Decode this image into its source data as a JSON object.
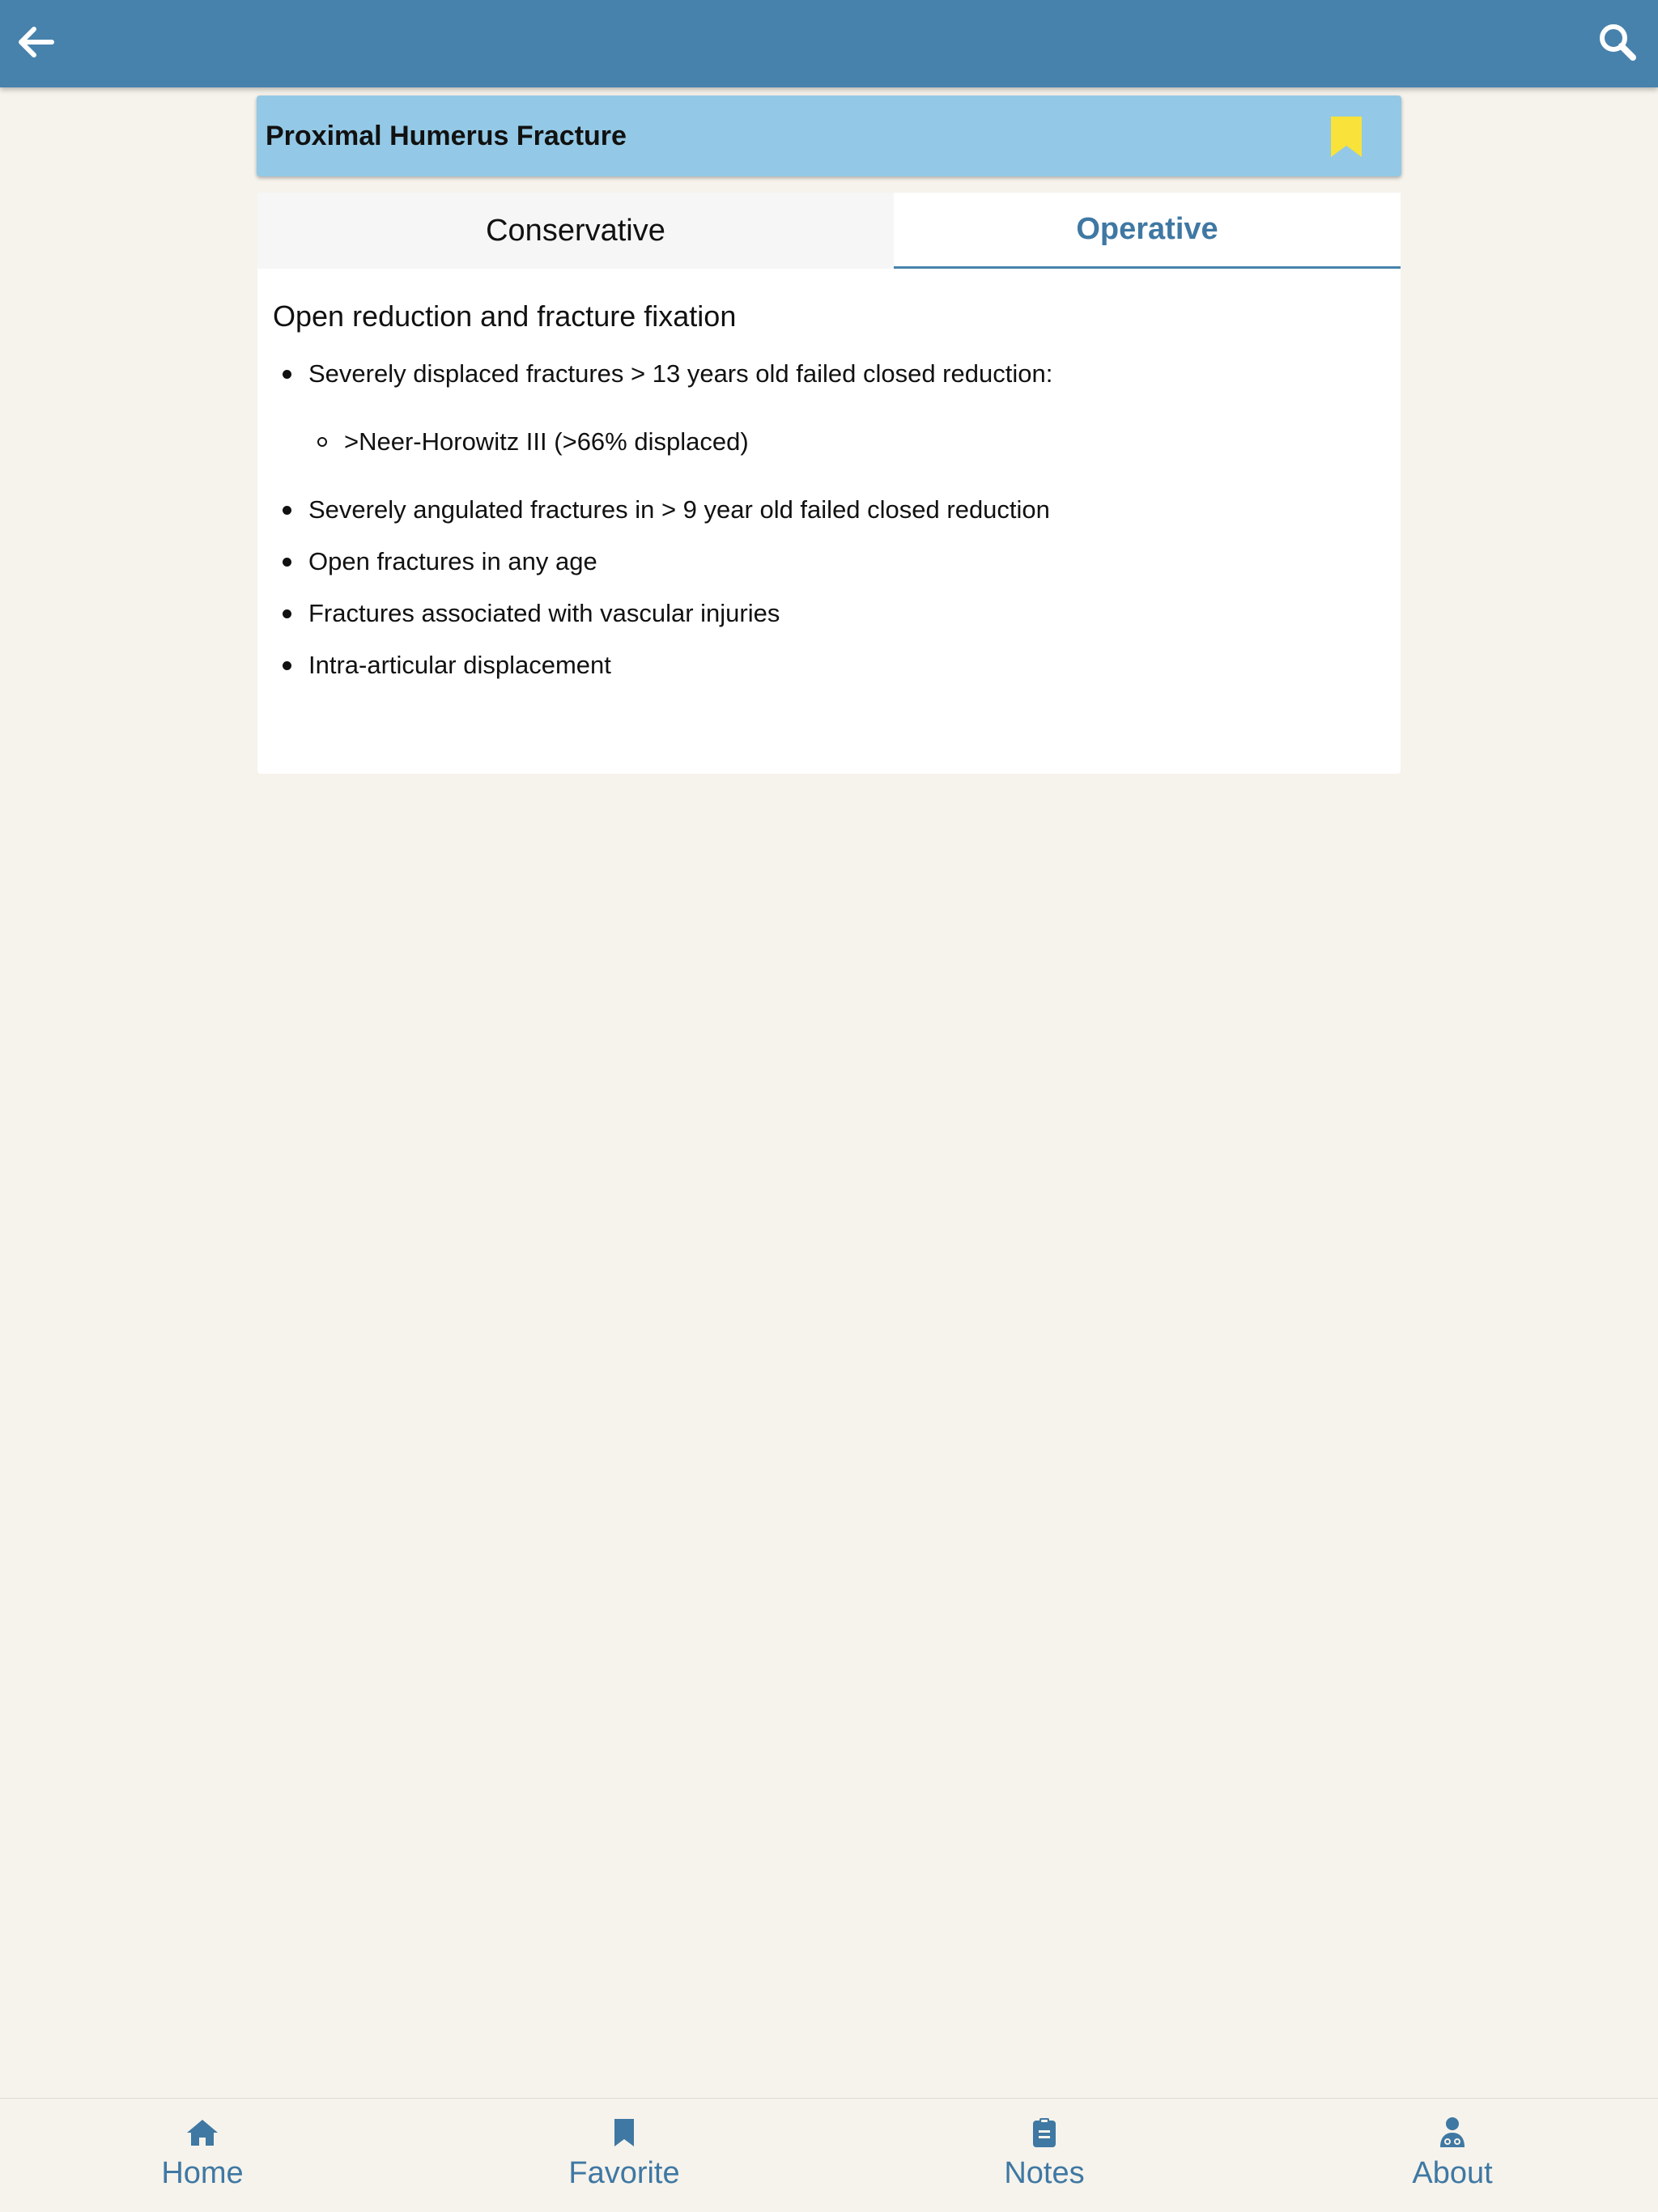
{
  "header": {
    "back_icon": "arrow-left-icon",
    "search_icon": "search-icon",
    "bar_color": "#4782ac"
  },
  "topic": {
    "title": "Proximal Humerus Fracture",
    "bookmark_icon": "bookmark-icon",
    "bookmark_color": "#f9e23a",
    "card_color": "#93c9e6"
  },
  "tabs": [
    {
      "label": "Conservative",
      "selected": false
    },
    {
      "label": "Operative",
      "selected": true
    }
  ],
  "content": {
    "intro": "Open reduction and fracture fixation",
    "items": [
      {
        "text": "Severely displaced fractures > 13 years old failed closed reduction:",
        "subitems": [
          ">Neer-Horowitz III (>66% displaced)"
        ]
      },
      {
        "text": "Severely angulated fractures in > 9 year old failed closed reduction"
      },
      {
        "text": "Open fractures in any age"
      },
      {
        "text": "Fractures associated with vascular injuries"
      },
      {
        "text": "Intra-articular displacement"
      }
    ]
  },
  "bottom_nav": [
    {
      "label": "Home",
      "icon": "home-icon"
    },
    {
      "label": "Favorite",
      "icon": "bookmark-icon"
    },
    {
      "label": "Notes",
      "icon": "clipboard-icon"
    },
    {
      "label": "About",
      "icon": "doctor-icon"
    }
  ],
  "colors": {
    "background": "#f6f3ec",
    "accent": "#3f78a3"
  }
}
